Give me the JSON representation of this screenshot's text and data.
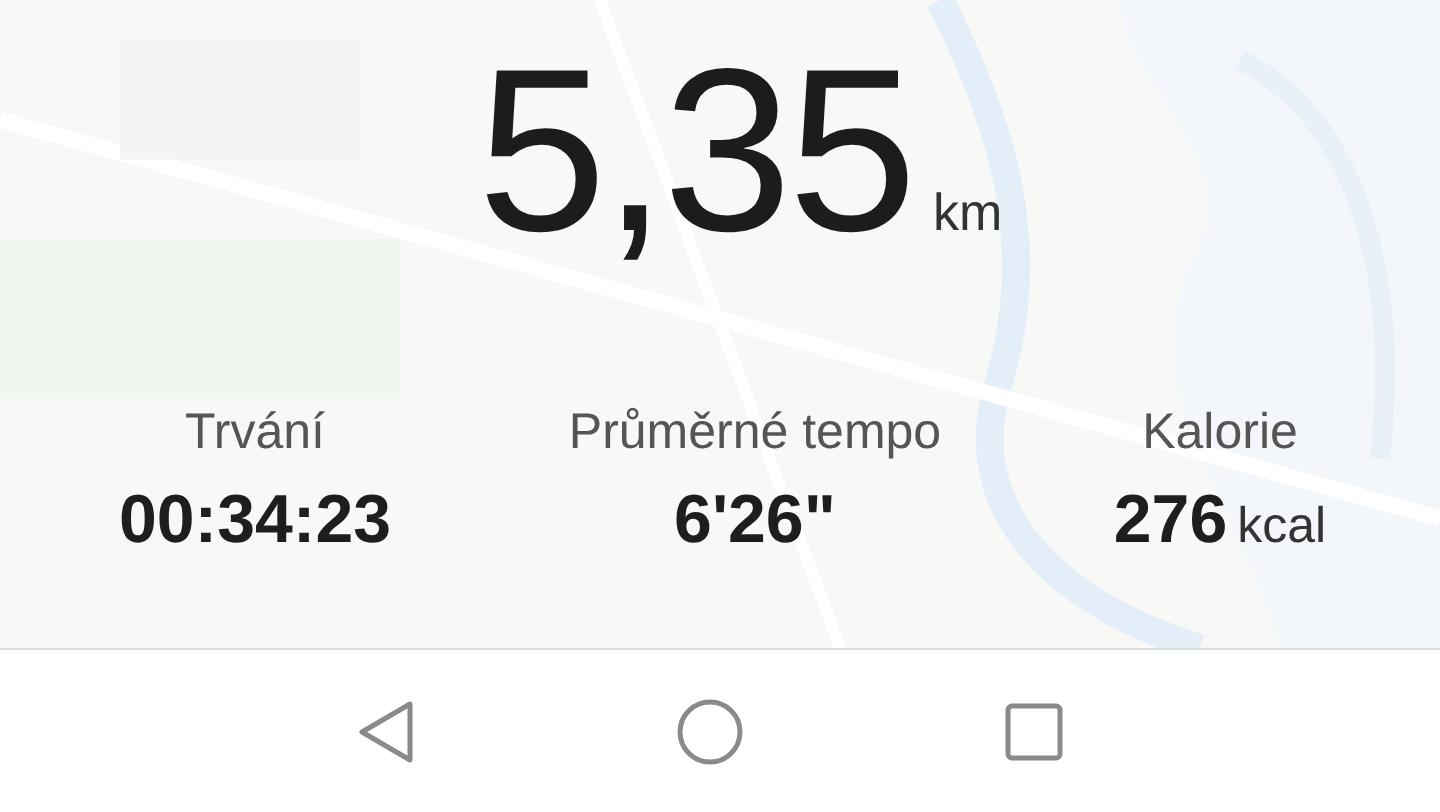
{
  "distance": {
    "value": "5,35",
    "unit": "km"
  },
  "stats": [
    {
      "label": "Trvání",
      "value": "00:34:23"
    },
    {
      "label": "Průměrné tempo",
      "value": "6'26\""
    },
    {
      "label": "Kalorie",
      "value": "276",
      "unit": "kcal"
    }
  ],
  "nav_bar": {
    "buttons": [
      {
        "kind": "back"
      },
      {
        "kind": "home"
      },
      {
        "kind": "recents"
      }
    ]
  }
}
